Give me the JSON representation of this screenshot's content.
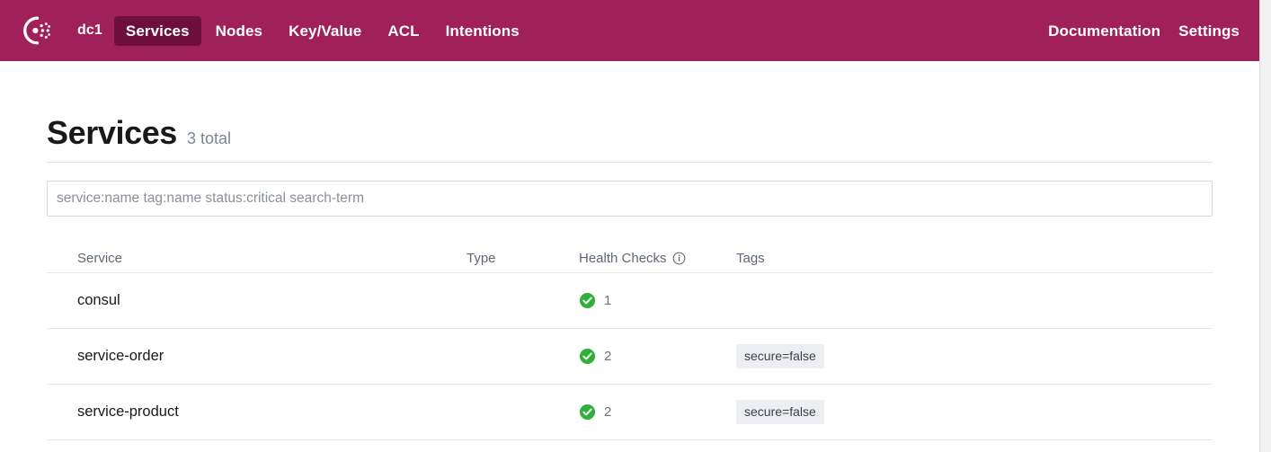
{
  "navbar": {
    "logo_icon": "consul-logo-icon",
    "datacenter": "dc1",
    "items": [
      {
        "label": "Services",
        "active": true
      },
      {
        "label": "Nodes",
        "active": false
      },
      {
        "label": "Key/Value",
        "active": false
      },
      {
        "label": "ACL",
        "active": false
      },
      {
        "label": "Intentions",
        "active": false
      }
    ],
    "right_items": [
      {
        "label": "Documentation"
      },
      {
        "label": "Settings"
      }
    ],
    "background_color": "#a02059",
    "active_color": "#6c0f3c"
  },
  "page": {
    "title": "Services",
    "count_label": "3 total"
  },
  "search": {
    "value": "",
    "placeholder": "service:name tag:name status:critical search-term"
  },
  "table": {
    "headers": {
      "service": "Service",
      "type": "Type",
      "health": "Health Checks",
      "health_info_icon": "info-circle-icon",
      "tags": "Tags"
    },
    "rows": [
      {
        "service": "consul",
        "type": "",
        "health_icon": "check-circle-icon",
        "health_count": "1",
        "health_color": "#2eb039",
        "tags": []
      },
      {
        "service": "service-order",
        "type": "",
        "health_icon": "check-circle-icon",
        "health_count": "2",
        "health_color": "#2eb039",
        "tags": [
          "secure=false"
        ]
      },
      {
        "service": "service-product",
        "type": "",
        "health_icon": "check-circle-icon",
        "health_count": "2",
        "health_color": "#2eb039",
        "tags": [
          "secure=false"
        ]
      }
    ]
  }
}
